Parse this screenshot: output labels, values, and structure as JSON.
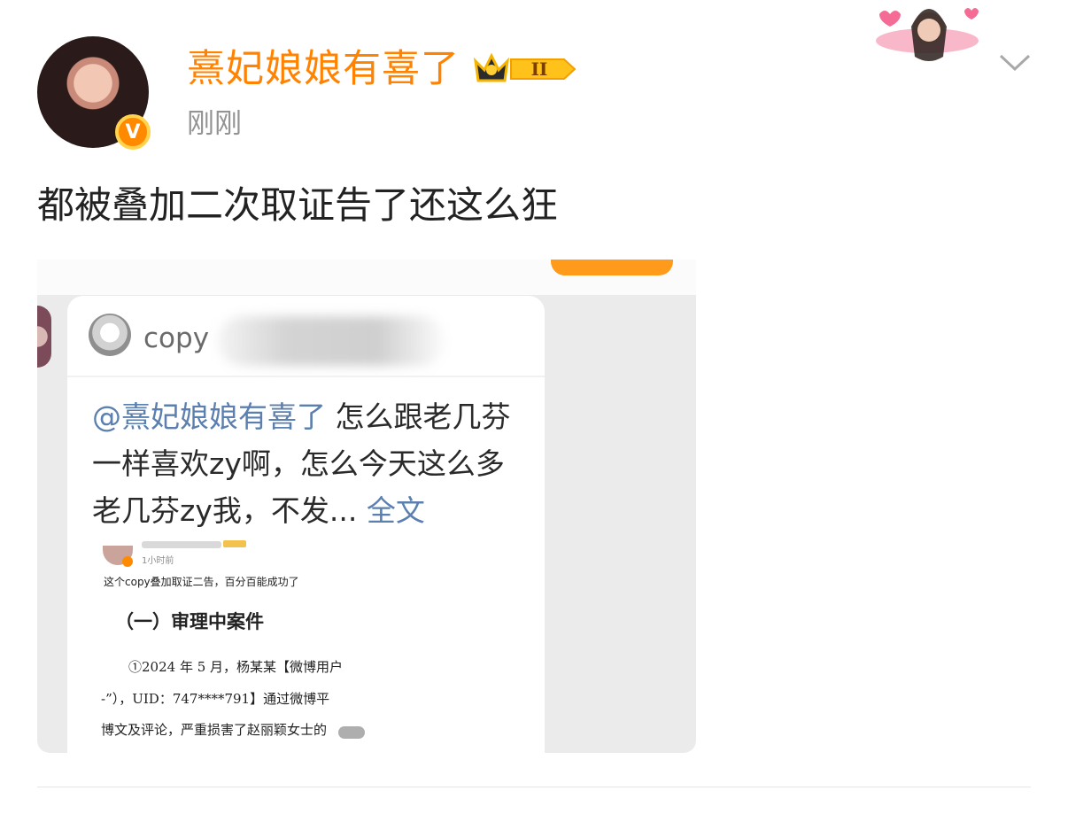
{
  "post": {
    "username": "熹妃娘娘有喜了",
    "level_badge": "II",
    "verified_badge": "V",
    "timestamp": "刚刚",
    "text": "都被叠加二次取证告了还这么狂"
  },
  "embedded": {
    "card": {
      "username_prefix": "copy",
      "mention": "@熹妃娘娘有喜了",
      "comment_body": "怎么跟老几芬一样喜欢zy啊，怎么今天这么多老几芬zy我，不发...",
      "more_link": "全文"
    },
    "inner_post": {
      "time": "1小时前",
      "text": "这个copy叠加取证二告，百分百能成功了"
    },
    "document": {
      "heading": "（一）审理中案件",
      "lines": [
        "①2024 年 5 月，杨某某【微博用户",
        "-”），UID：747****791】通过微博平",
        "博文及评论，严重损害了赵丽颖女士的"
      ]
    }
  },
  "colors": {
    "username": "#ff8200",
    "link": "#5b7fae",
    "timestamp": "#939393"
  },
  "icons": [
    "crown-level-icon",
    "verified-v-icon",
    "chevron-down-icon"
  ]
}
